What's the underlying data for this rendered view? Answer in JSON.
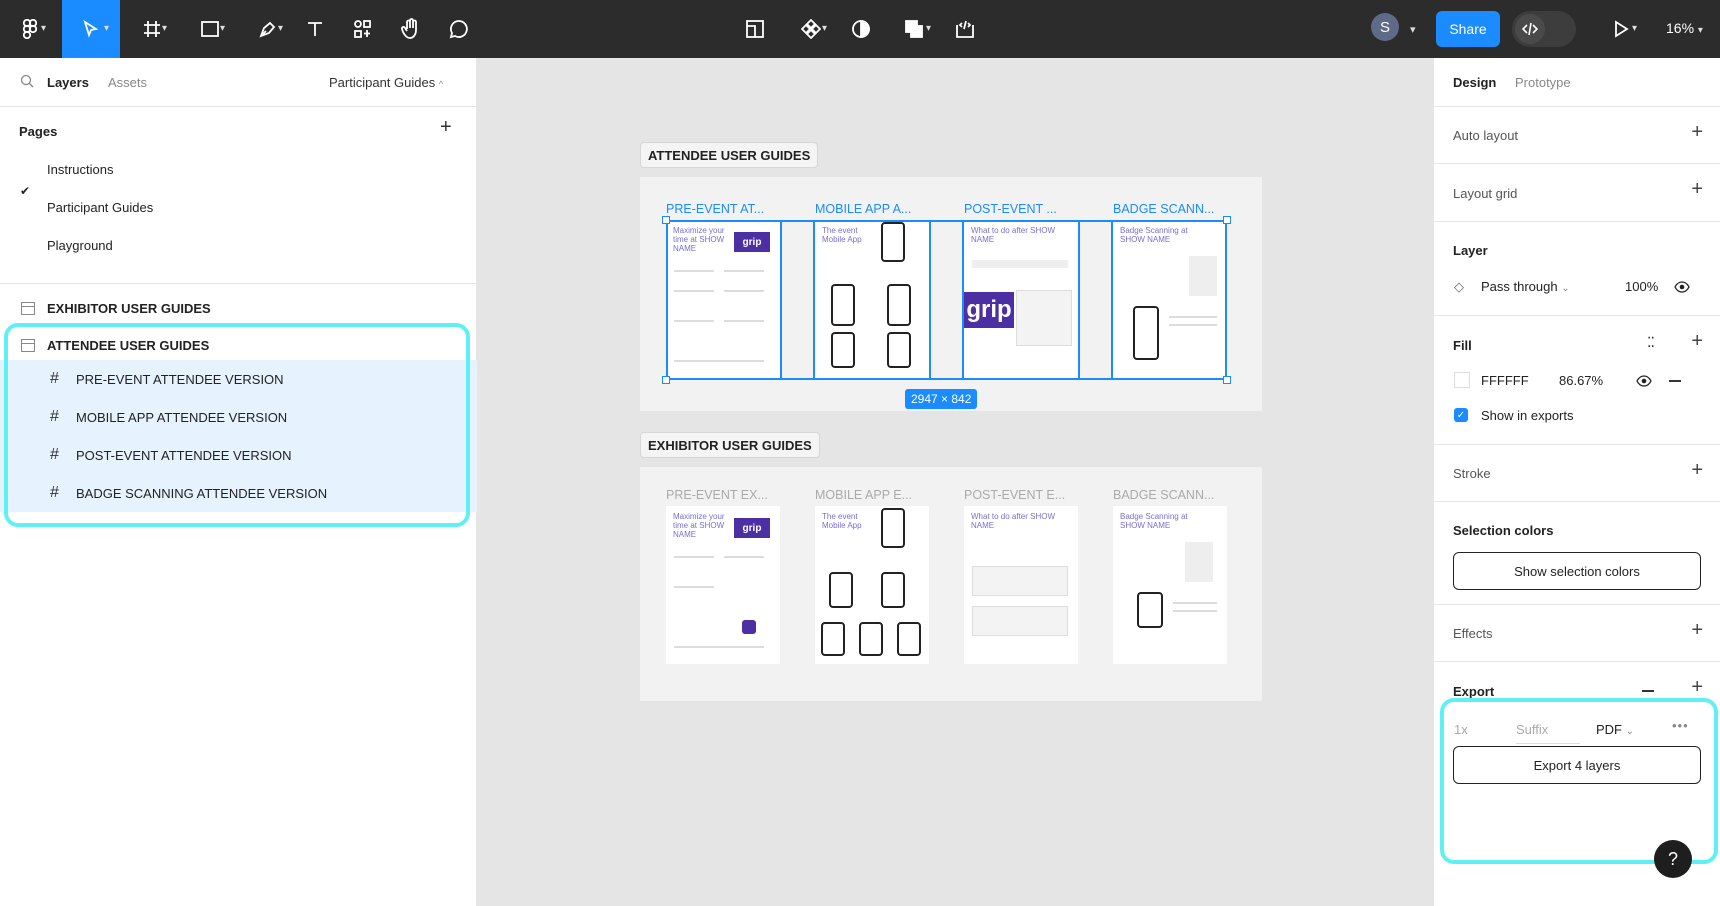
{
  "toolbar": {
    "tools": [
      "figma-menu",
      "move",
      "frame",
      "shape",
      "pen",
      "text",
      "resources",
      "hand",
      "comment"
    ],
    "center_tools": [
      "crop",
      "components",
      "mask",
      "boolean",
      "dev-handoff"
    ],
    "avatar_initial": "S",
    "share_label": "Share",
    "zoom_label": "16%"
  },
  "left_panel": {
    "tab_layers": "Layers",
    "tab_assets": "Assets",
    "current_page": "Participant Guides",
    "pages_heading": "Pages",
    "pages": [
      "Instructions",
      "Participant Guides",
      "Playground"
    ],
    "layers": [
      {
        "label": "EXHIBITOR USER GUIDES"
      },
      {
        "label": "ATTENDEE USER GUIDES"
      },
      {
        "label": "PRE-EVENT ATTENDEE VERSION"
      },
      {
        "label": "MOBILE APP ATTENDEE VERSION"
      },
      {
        "label": "POST-EVENT ATTENDEE VERSION"
      },
      {
        "label": "BADGE SCANNING ATTENDEE VERSION"
      }
    ]
  },
  "canvas": {
    "attendee_label": "ATTENDEE USER GUIDES",
    "exhibitor_label": "EXHIBITOR USER GUIDES",
    "attendee_frames": [
      "PRE-EVENT AT...",
      "MOBILE APP A...",
      "POST-EVENT ...",
      "BADGE SCANN..."
    ],
    "exhibitor_frames": [
      "PRE-EVENT EX...",
      "MOBILE APP E...",
      "POST-EVENT E...",
      "BADGE SCANN..."
    ],
    "thumb_texts": [
      "Maximize your time at SHOW NAME",
      "The event Mobile App",
      "What to do after SHOW NAME",
      "Badge Scanning at SHOW NAME"
    ],
    "logo_text": "grip",
    "selection_size": "2947 × 842"
  },
  "right_panel": {
    "tab_design": "Design",
    "tab_prototype": "Prototype",
    "auto_layout": "Auto layout",
    "layout_grid": "Layout grid",
    "layer_heading": "Layer",
    "blend_mode": "Pass through",
    "layer_opacity": "100%",
    "fill_heading": "Fill",
    "fill_hex": "FFFFFF",
    "fill_opacity": "86.67%",
    "show_in_exports": "Show in exports",
    "stroke_heading": "Stroke",
    "selection_colors_heading": "Selection colors",
    "show_selection_colors": "Show selection colors",
    "effects_heading": "Effects",
    "export_heading": "Export",
    "export_scale": "1x",
    "export_suffix_placeholder": "Suffix",
    "export_format": "PDF",
    "export_button": "Export 4 layers",
    "help": "?"
  },
  "colors": {
    "accent": "#1a8cff",
    "highlight": "#5ff0f5",
    "toolbar_bg": "#2c2c2c",
    "brand_purple": "#4b2fa3"
  }
}
